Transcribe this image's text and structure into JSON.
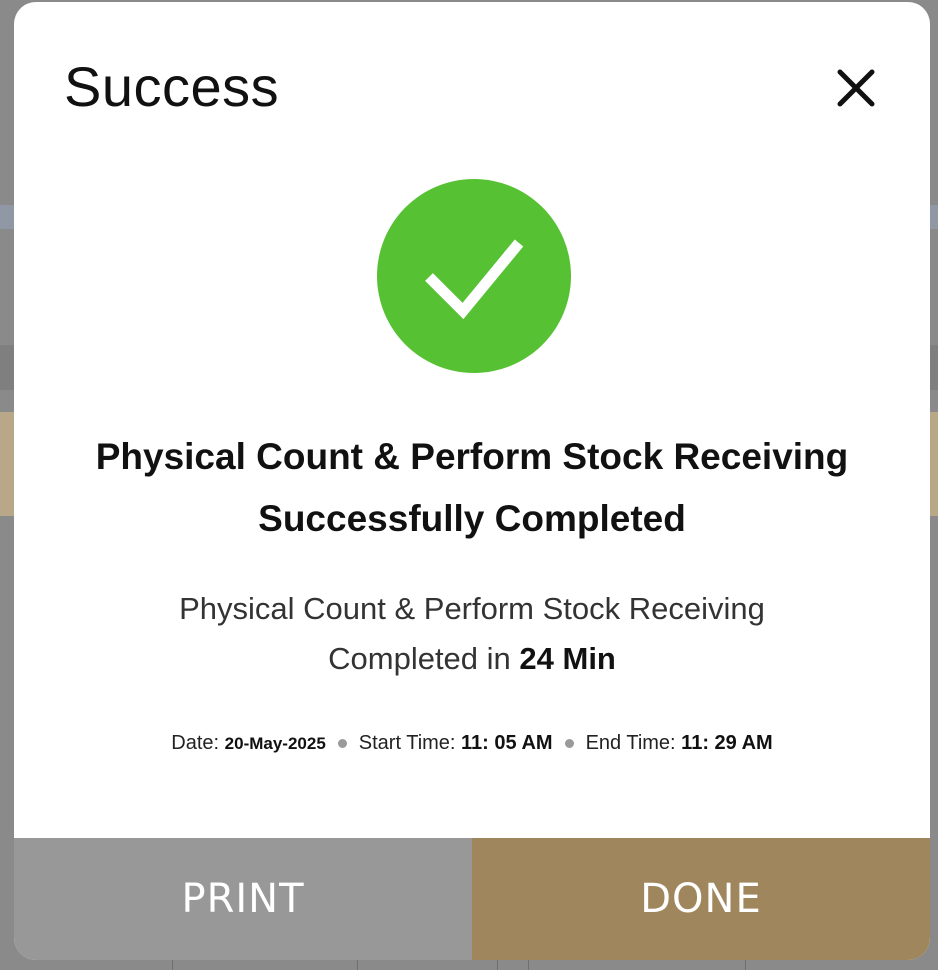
{
  "dialog": {
    "title": "Success",
    "close_icon": "close-icon",
    "status_icon": "checkmark-icon",
    "accent_color": "#56c233",
    "headline_line1": "Physical Count & Perform Stock Receiving",
    "headline_line2": "Successfully Completed",
    "subtext_line1": "Physical Count & Perform Stock Receiving",
    "subtext_prefix": "Completed in ",
    "duration": "24 Min",
    "date_label": "Date: ",
    "date_value": "20-May-2025",
    "start_label": "Start Time: ",
    "start_value": "11: 05 AM",
    "end_label": "End Time: ",
    "end_value": "11: 29 AM",
    "print_label": "PRINT",
    "done_label": "DONE",
    "print_color": "#989898",
    "done_color": "#a0865d"
  }
}
